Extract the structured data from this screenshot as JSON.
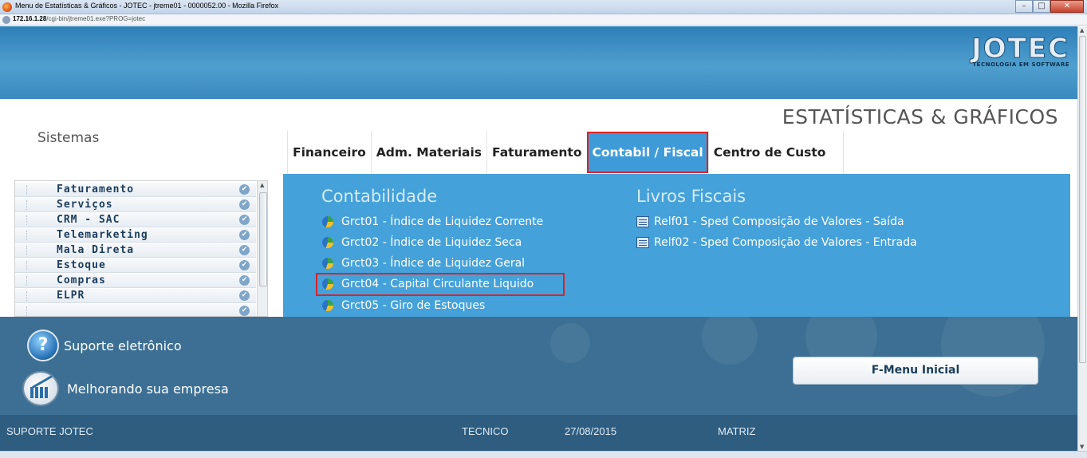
{
  "browser": {
    "window_title": "Menu de Estatísticas & Gráficos - JOTEC - jtreme01 - 0000052.00 - Mozilla Firefox",
    "url_host": "172.16.1.28",
    "url_path": "/cgi-bin/jtreme01.exe?PROG=jotec"
  },
  "header": {
    "logo_text": "JOTEC",
    "logo_sub": "TECNOLOGIA EM SOFTWARE",
    "page_title": "ESTATÍSTICAS & GRÁFICOS"
  },
  "sidebar": {
    "heading": "Sistemas",
    "items": [
      {
        "label": "Faturamento"
      },
      {
        "label": "Serviços"
      },
      {
        "label": "CRM - SAC"
      },
      {
        "label": "Telemarketing"
      },
      {
        "label": "Mala Direta"
      },
      {
        "label": "Estoque"
      },
      {
        "label": "Compras"
      },
      {
        "label": "ELPR"
      }
    ]
  },
  "tabs": [
    {
      "label": "Financeiro"
    },
    {
      "label": "Adm. Materiais"
    },
    {
      "label": "Faturamento"
    },
    {
      "label": "Contabil / Fiscal",
      "active": true
    },
    {
      "label": "Centro de Custo"
    }
  ],
  "contabilidade": {
    "title": "Contabilidade",
    "links": [
      {
        "label": "Grct01 - Índice de Liquidez Corrente",
        "icon": "pie-chart-icon"
      },
      {
        "label": "Grct02 - Índice de Liquidez Seca",
        "icon": "pie-chart-icon"
      },
      {
        "label": "Grct03 - Índice de Liquidez Geral",
        "icon": "pie-chart-icon"
      },
      {
        "label": "Grct04 - Capital Circulante Liquido",
        "icon": "pie-chart-icon"
      },
      {
        "label": "Grct05 - Giro de Estoques",
        "icon": "pie-chart-icon"
      }
    ]
  },
  "livros_fiscais": {
    "title": "Livros Fiscais",
    "links": [
      {
        "label": "Relf01 - Sped Composição de Valores - Saída",
        "icon": "document-list-icon"
      },
      {
        "label": "Relf02 - Sped Composição de Valores - Entrada",
        "icon": "document-list-icon"
      }
    ]
  },
  "footer": {
    "support_label": "Suporte eletrônico",
    "improve_label": "Melhorando sua empresa",
    "fmenu_label": "F-Menu Inicial"
  },
  "status": {
    "left": "SUPORTE JOTEC",
    "user": "TECNICO",
    "date": "27/08/2015",
    "branch": "MATRIZ"
  },
  "colors": {
    "accent_blue": "#45a1d9",
    "highlight_red": "#d9232a",
    "footer_blue": "#3c6f93"
  }
}
